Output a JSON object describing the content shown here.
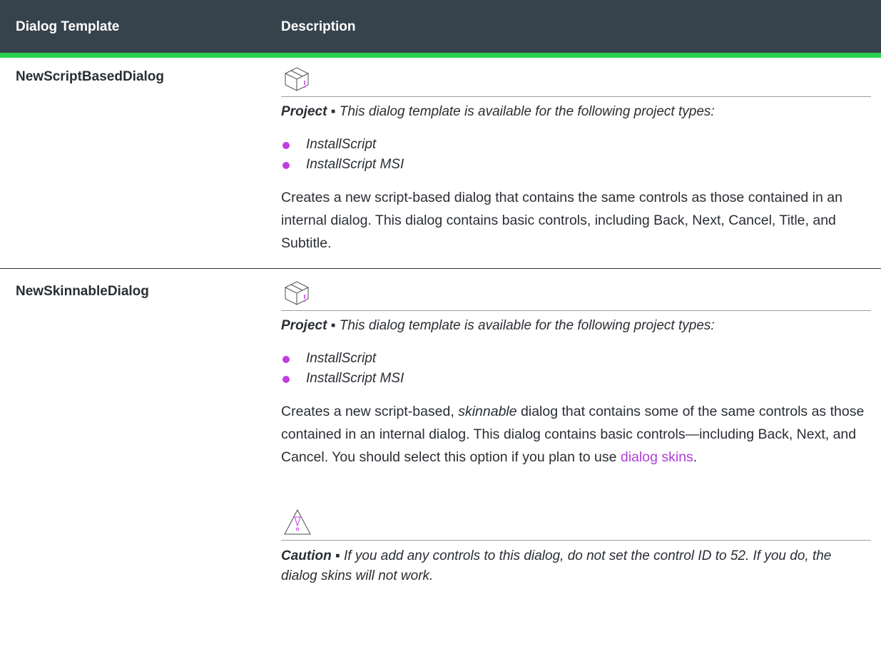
{
  "header": {
    "col1": "Dialog Template",
    "col2": "Description"
  },
  "rows": [
    {
      "name": "NewScriptBasedDialog",
      "note_label": "Project",
      "note_sep": " ▪ ",
      "note_text": "This dialog template is available for the following project types:",
      "bullets": [
        "InstallScript",
        "InstallScript MSI"
      ],
      "description": "Creates a new script-based dialog that contains the same controls as those contained in an internal dialog. This dialog contains basic controls, including Back, Next, Cancel, Title, and Subtitle."
    },
    {
      "name": "NewSkinnableDialog",
      "note_label": "Project",
      "note_sep": " ▪ ",
      "note_text": "This dialog template is available for the following project types:",
      "bullets": [
        "InstallScript",
        "InstallScript MSI"
      ],
      "description_pre": "Creates a new script-based, ",
      "description_em": "skinnable",
      "description_mid": " dialog that contains some of the same controls as those contained in an internal dialog. This dialog contains basic controls—including Back, Next, and Cancel. You should select this option if you plan to use ",
      "description_link": "dialog skins",
      "description_post": ".",
      "caution_label": "Caution",
      "caution_sep": " ▪ ",
      "caution_text": "If you add any controls to this dialog, do not set the control ID to 52. If you do, the dialog skins will not work."
    }
  ],
  "colors": {
    "header_bg": "#36434d",
    "header_accent": "#29d04f",
    "bullet": "#c03de0",
    "link": "#b13fd9"
  },
  "icons": [
    "project-box-icon",
    "caution-triangle-icon"
  ]
}
